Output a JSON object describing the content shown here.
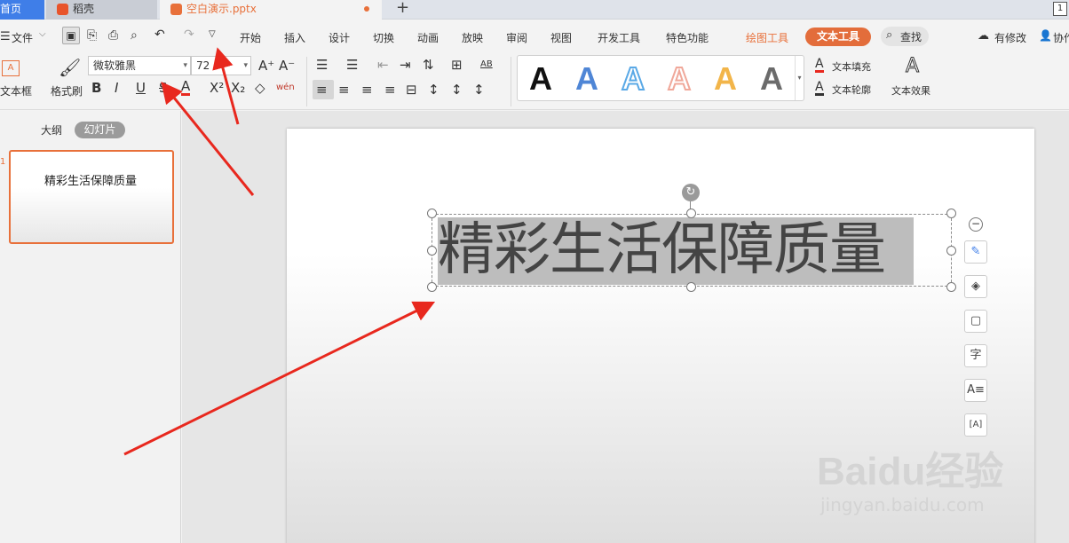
{
  "tabs": {
    "home": "首页",
    "docer": "稻壳",
    "document": "空白演示.pptx",
    "new_tab": "+",
    "window_badge": "1"
  },
  "menu": {
    "file": "文件",
    "items": [
      "开始",
      "插入",
      "设计",
      "切换",
      "动画",
      "放映",
      "审阅",
      "视图",
      "开发工具",
      "特色功能"
    ],
    "drawing_tools": "绘图工具",
    "text_tools": "文本工具",
    "search": "查找",
    "cloud_status": "有修改",
    "collab": "协作"
  },
  "ribbon": {
    "textbox_label": "文本框",
    "format_painter": "格式刷",
    "font_name": "微软雅黑",
    "font_size": "72",
    "text_fill": "文本填充",
    "text_outline": "文本轮廓",
    "text_effects": "文本效果",
    "text_style_glyph": "A",
    "pinyin_glyph": "wén"
  },
  "gallery": {
    "styles": [
      {
        "glyph": "A",
        "color": "#111111"
      },
      {
        "glyph": "A",
        "color": "#4f86d6"
      },
      {
        "glyph": "A",
        "color": "#5aa9e6"
      },
      {
        "glyph": "A",
        "color": "#f0a89a"
      },
      {
        "glyph": "A",
        "color": "#f2b54a"
      },
      {
        "glyph": "A",
        "color": "#6b6b6b"
      }
    ]
  },
  "panel": {
    "outline_tab": "大纲",
    "slides_tab": "幻灯片",
    "slide_number": "1",
    "thumb_text": "精彩生活保障质量"
  },
  "slide": {
    "title_text": "精彩生活保障质量"
  },
  "watermark": {
    "brand": "Baidu经验",
    "url": "jingyan.baidu.com"
  },
  "colors": {
    "accent": "#e8703a",
    "tab_active_bg": "#3f7ee8",
    "arrow": "#e8281e",
    "selection": "#bdbdbd"
  }
}
